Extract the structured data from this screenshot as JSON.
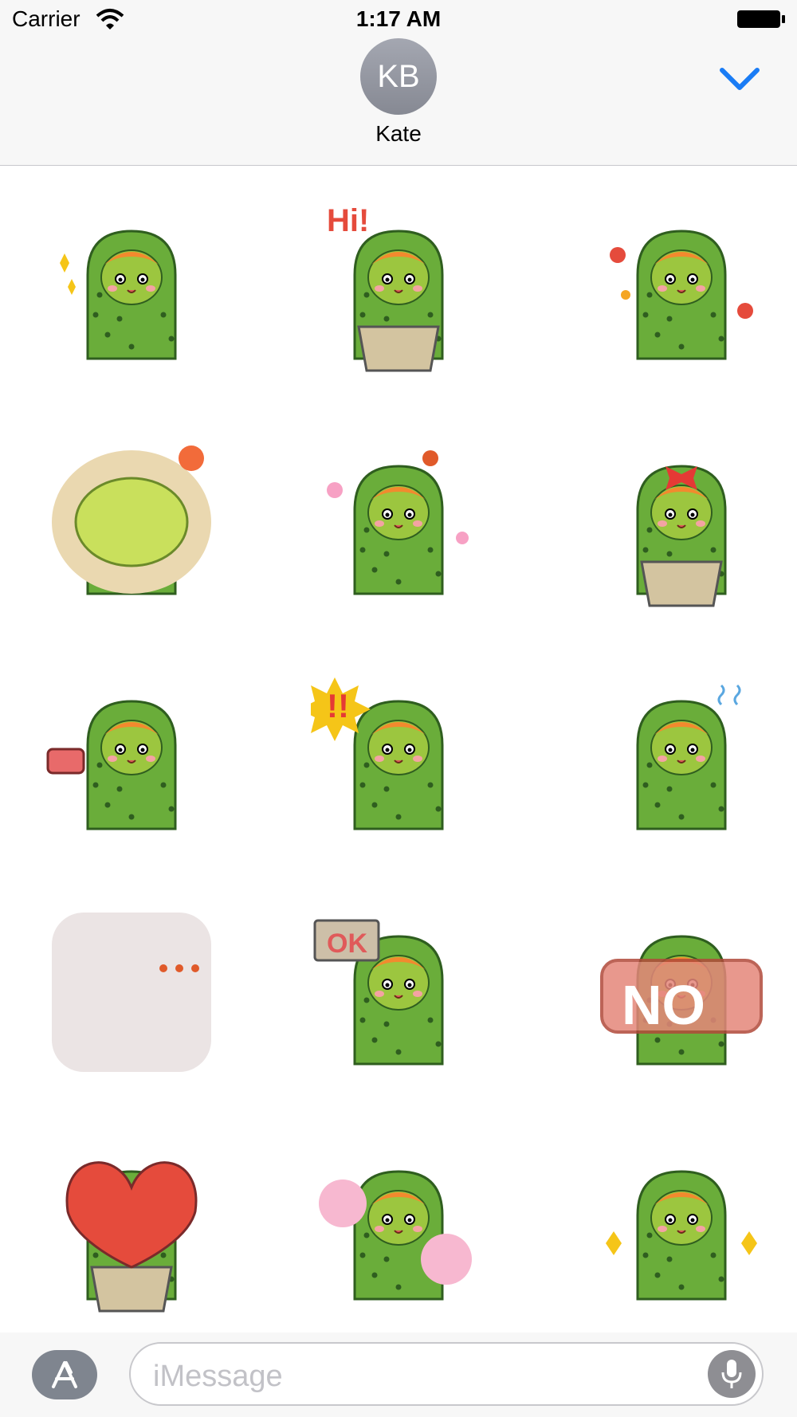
{
  "status_bar": {
    "carrier": "Carrier",
    "time": "1:17 AM"
  },
  "conversation": {
    "avatar_initials": "KB",
    "contact_name": "Kate"
  },
  "stickers": [
    {
      "label": "cactus-thumbs-up"
    },
    {
      "label": "cactus-hi-in-pot",
      "text": "Hi!"
    },
    {
      "label": "cactus-dancing-flowers"
    },
    {
      "label": "cactus-sunbathing"
    },
    {
      "label": "cactus-shy-blush"
    },
    {
      "label": "cactus-girl-with-bow-in-pot"
    },
    {
      "label": "cactus-lifting-dumbbell"
    },
    {
      "label": "cactus-surprised-exclaim",
      "text": "!!"
    },
    {
      "label": "cactus-sweating-nervous"
    },
    {
      "label": "cactus-in-corner-sulking"
    },
    {
      "label": "cactus-ok-sign",
      "text": "OK"
    },
    {
      "label": "cactus-no-sign",
      "text": "NO"
    },
    {
      "label": "heart-cacti-in-pot"
    },
    {
      "label": "cactus-cotton-candy"
    },
    {
      "label": "cactus-excited-hands"
    }
  ],
  "input_bar": {
    "placeholder": "iMessage"
  },
  "colors": {
    "accent": "#1a7cf5",
    "cactus": "#6aad3a",
    "cactus_face": "#9cc63f",
    "hair": "#f28a2e"
  }
}
